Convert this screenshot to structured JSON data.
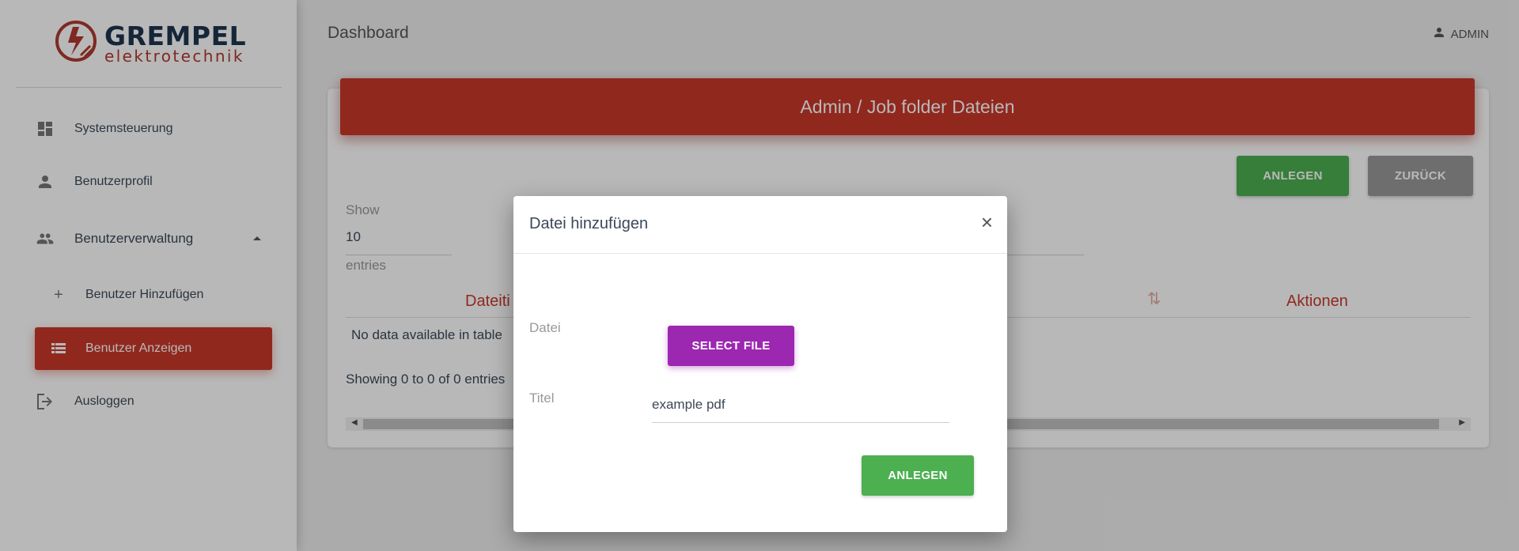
{
  "brand": {
    "line1": "GREMPEL",
    "line2": "elektrotechnik"
  },
  "sidebar": {
    "items": [
      {
        "label": "Systemsteuerung",
        "icon": "dashboard-icon"
      },
      {
        "label": "Benutzerprofil",
        "icon": "person-icon"
      },
      {
        "label": "Benutzerverwaltung",
        "icon": "people-icon",
        "expanded": true
      },
      {
        "label": "Benutzer Hinzufügen",
        "icon": "plus-icon"
      },
      {
        "label": "Benutzer Anzeigen",
        "icon": "list-icon",
        "active": true
      },
      {
        "label": "Ausloggen",
        "icon": "logout-icon"
      }
    ]
  },
  "header": {
    "title": "Dashboard",
    "user": "ADMIN"
  },
  "card": {
    "title": "Admin / Job folder Dateien",
    "create_label": "ANLEGEN",
    "back_label": "ZURÜCK",
    "show_label": "Show",
    "show_value": "10",
    "entries_label": "entries",
    "columns": [
      "Dateiti",
      "Aktionen"
    ],
    "empty_text": "No data available in table",
    "info_text": "Showing 0 to 0 of 0 entries"
  },
  "modal": {
    "title": "Datei hinzufügen",
    "close": "×",
    "file_label": "Datei",
    "select_file_label": "SELECT FILE",
    "title_label": "Titel",
    "title_value": "example pdf",
    "submit_label": "ANLEGEN"
  },
  "colors": {
    "primary": "#c9382a",
    "success": "#4caf50",
    "neutral": "#999999",
    "accent": "#9c27b0"
  }
}
